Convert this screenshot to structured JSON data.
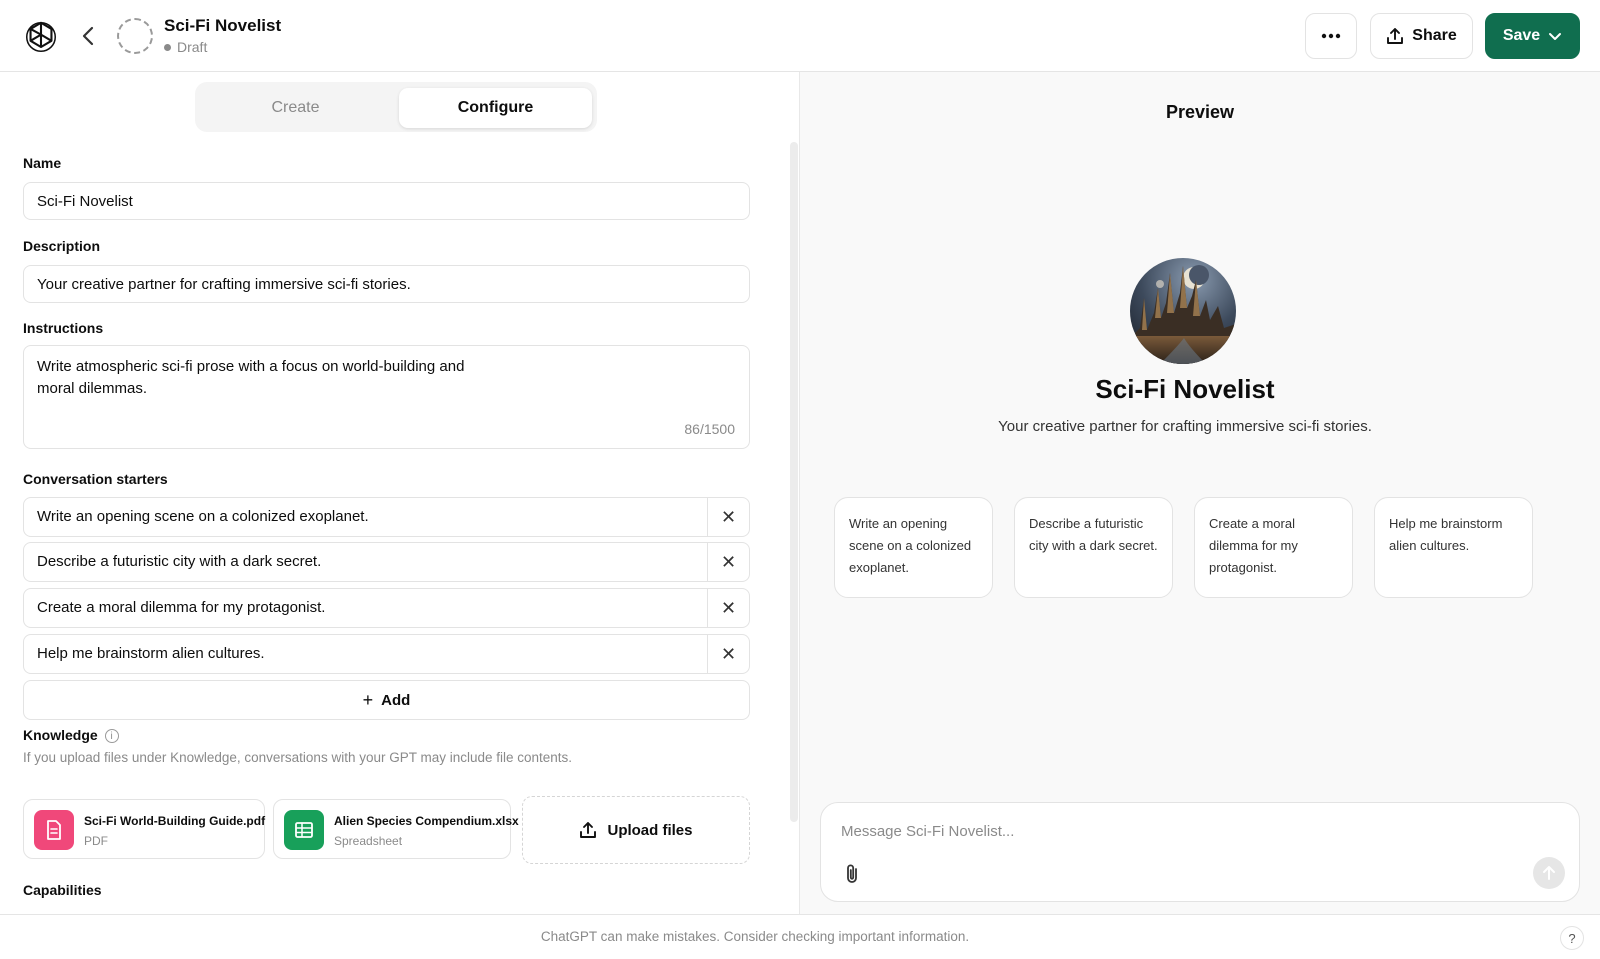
{
  "header": {
    "title": "Sci-Fi Novelist",
    "status": "Draft",
    "share_label": "Share",
    "save_label": "Save"
  },
  "tabs": [
    {
      "label": "Create",
      "active": false
    },
    {
      "label": "Configure",
      "active": true
    }
  ],
  "form": {
    "name_label": "Name",
    "name_value": "Sci-Fi Novelist",
    "description_label": "Description",
    "description_value": "Your creative partner for crafting immersive sci-fi stories.",
    "instructions_label": "Instructions",
    "instructions_value": "Write atmospheric sci-fi prose with a focus on world-building and moral dilemmas.",
    "instructions_counter": "86/1500",
    "starters_label": "Conversation starters",
    "starters": [
      "Write an opening scene on a colonized exoplanet.",
      "Describe a futuristic city with a dark secret.",
      "Create a moral dilemma for my protagonist.",
      "Help me brainstorm alien cultures."
    ],
    "add_label": "Add",
    "knowledge_label": "Knowledge",
    "knowledge_hint": "If you upload files under Knowledge, conversations with your GPT may include file contents.",
    "files": [
      {
        "name": "Sci-Fi World-Building Guide.pdf",
        "type": "PDF",
        "color": "#f0487a"
      },
      {
        "name": "Alien Species Compendium.xlsx",
        "type": "Spreadsheet",
        "color": "#18a05a"
      }
    ],
    "upload_label": "Upload files",
    "capabilities_label": "Capabilities"
  },
  "preview": {
    "title": "Preview",
    "name": "Sci-Fi Novelist",
    "description": "Your creative partner for crafting immersive sci-fi stories.",
    "cards": [
      "Write an opening scene on a colonized exoplanet.",
      "Describe a futuristic city with a dark secret.",
      "Create a moral dilemma for my protagonist.",
      "Help me brainstorm alien cultures."
    ],
    "composer_placeholder": "Message Sci-Fi Novelist..."
  },
  "footer": {
    "disclaimer": "ChatGPT can make mistakes. Consider checking important information.",
    "help": "?"
  },
  "colors": {
    "accent": "#106e4f",
    "pdf_icon": "#f0487a",
    "sheet_icon": "#18a05a"
  }
}
